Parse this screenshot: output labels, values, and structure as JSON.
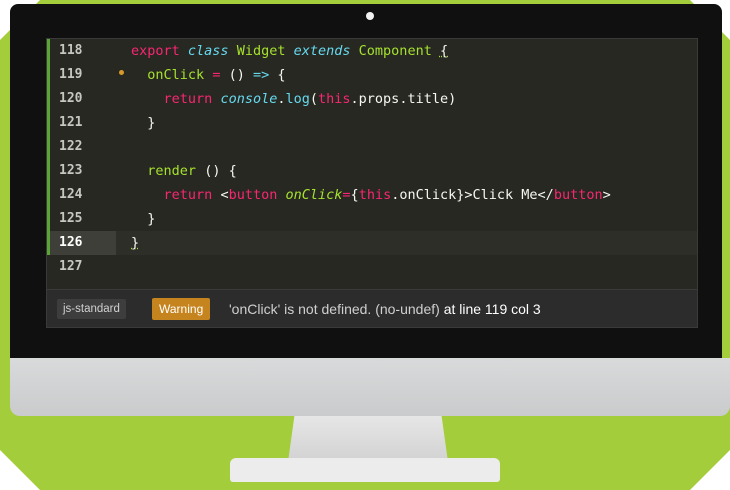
{
  "editor": {
    "lines": [
      {
        "num": "118",
        "tokens": [
          "export",
          "class",
          "Widget",
          "extends",
          "Component",
          "{"
        ]
      },
      {
        "num": "119",
        "tokens": [
          "onClick",
          "=",
          "()",
          "=>",
          "{"
        ]
      },
      {
        "num": "120",
        "tokens": [
          "return",
          "console",
          ".",
          "log",
          "(",
          "this",
          ".",
          "props",
          ".",
          "title",
          ")"
        ]
      },
      {
        "num": "121",
        "tokens": [
          "}"
        ]
      },
      {
        "num": "122",
        "tokens": []
      },
      {
        "num": "123",
        "tokens": [
          "render",
          "()",
          "{"
        ]
      },
      {
        "num": "124",
        "tokens": [
          "return",
          "<",
          "button",
          "onClick",
          "=",
          "{",
          "this",
          ".",
          "onClick",
          "}>",
          "Click Me",
          "</",
          "button",
          ">"
        ]
      },
      {
        "num": "125",
        "tokens": [
          "}"
        ]
      },
      {
        "num": "126",
        "tokens": [
          "}"
        ]
      },
      {
        "num": "127",
        "tokens": []
      }
    ],
    "active_line": "126",
    "warning_line": "119"
  },
  "status_bar": {
    "linter": "js-standard",
    "severity": "Warning",
    "message": "'onClick' is not defined. (no-undef)",
    "location": "at line 119 col 3"
  },
  "colors": {
    "background": "#a4cd3c",
    "editor_bg": "#272822",
    "keyword": "#f92672",
    "storage": "#66d9ef",
    "function": "#a6e22e",
    "warning": "#c5841d"
  }
}
